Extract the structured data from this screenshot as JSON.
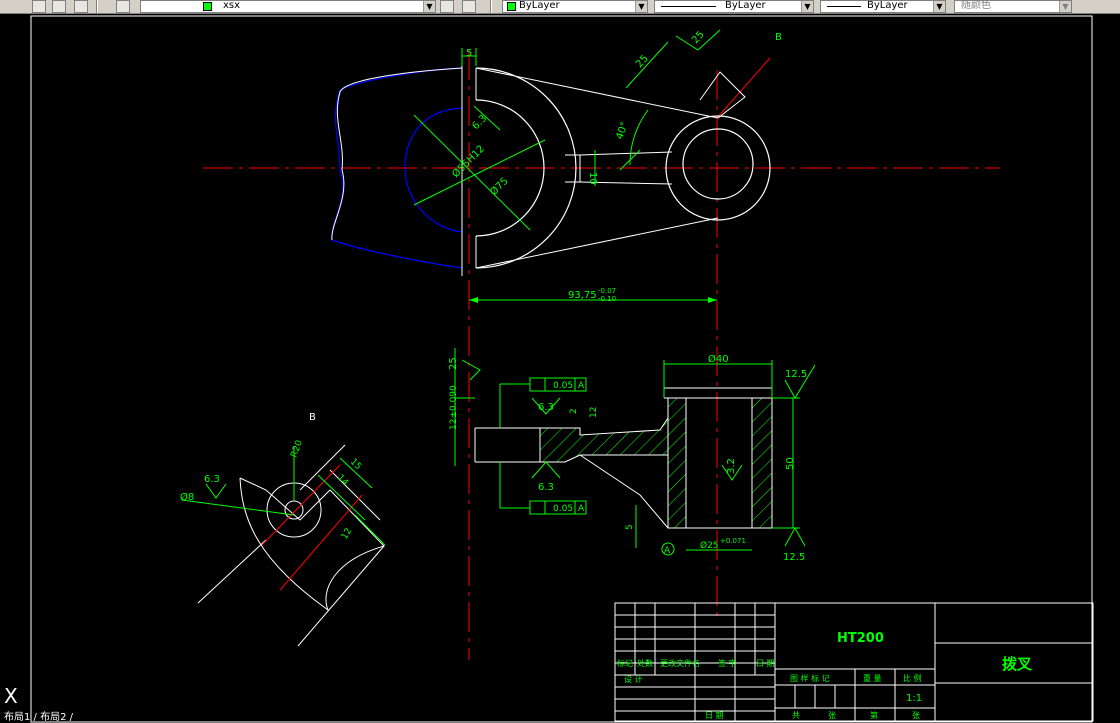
{
  "toolbar": {
    "layer_value": "xsx",
    "color_value": "ByLayer",
    "linetype_value": "ByLayer",
    "lineweight_value": "ByLayer",
    "plotstyle_value": "随颜色"
  },
  "colors": {
    "dim": "#00ff00",
    "center": "#ff0000",
    "outline": "#ffffff",
    "hidden": "#0000ff"
  },
  "dims": {
    "top_5": "5",
    "top_25": "25",
    "top_25b": "25",
    "top_40": "40°",
    "top_6_3": "6.3",
    "top_d55": "Ø55H12",
    "top_d75": "Ø75",
    "top_10": "10",
    "top_B": "B",
    "top_9375": "93,75",
    "top_9375_tol_upper": "-0.07",
    "top_9375_tol_lower": "-0.10",
    "front_25": "25",
    "front_12tol": "12±0.090",
    "front_gtol_up": "0.05",
    "front_gtol_up_ref": "A",
    "front_gtol_dn": "0.05",
    "front_gtol_dn_ref": "A",
    "front_6_3a": "6.3",
    "front_6_3b": "6.3",
    "front_2": "2",
    "front_12": "12",
    "front_d40": "Ø40",
    "front_12_5a": "12.5",
    "front_12_5b": "12.5",
    "front_3_2": "3.2",
    "front_50": "50",
    "front_5": "5",
    "front_A": "A",
    "front_d25": "Ø25",
    "front_d25_tol": "+0.071",
    "view_B": "B",
    "b_6_3": "6.3",
    "b_d8": "Ø8",
    "b_R20": "R20",
    "b_15": "15",
    "b_14": "14",
    "b_12": "12"
  },
  "titleblock": {
    "material": "HT200",
    "part_name": "拨叉",
    "scale": "1:1",
    "row_labels": [
      "标记",
      "处数",
      "更改文件名",
      "签 字",
      "日 期"
    ],
    "design": "设 计",
    "stage_mark": "图 样 标 记",
    "weight": "重 量",
    "ratio": "比 例",
    "bottom_labels": [
      "日 期",
      "共",
      "张",
      "第",
      "张"
    ]
  },
  "status": {
    "layout_tabs": "布局1 / 布局2 /"
  },
  "ucs_icon": "X"
}
